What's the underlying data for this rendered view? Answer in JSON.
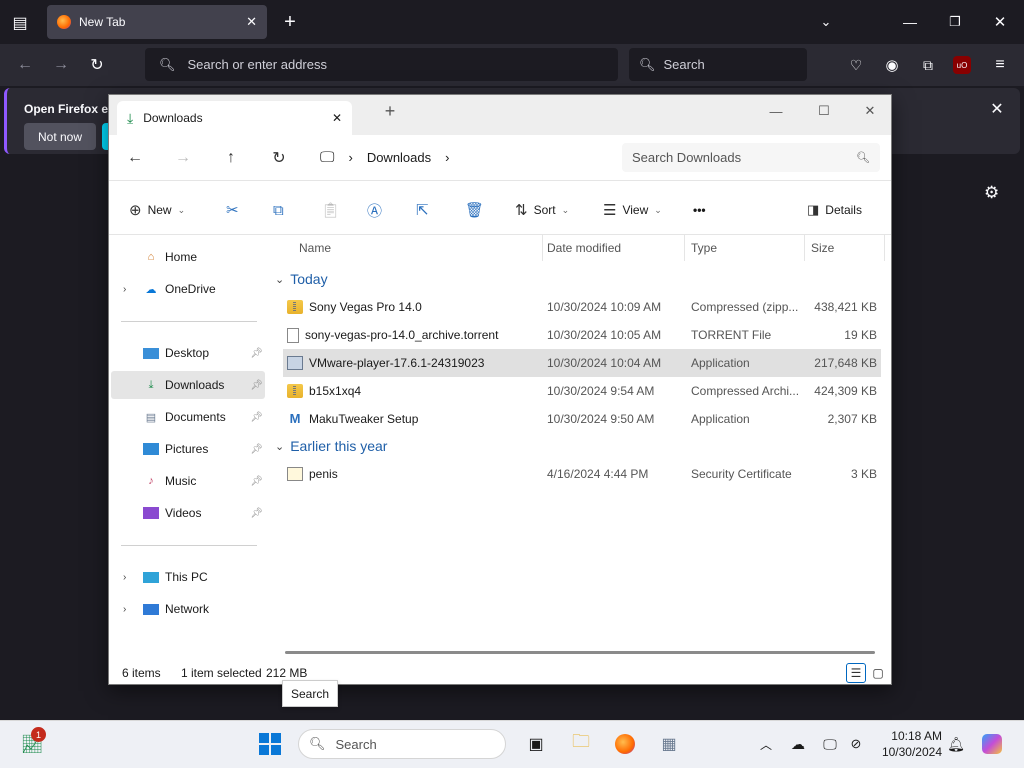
{
  "browser": {
    "tab_title": "New Tab",
    "url_placeholder": "Search or enter address",
    "search_placeholder": "Search",
    "notification_title": "Open Firefox ev",
    "notification_button": "Not now"
  },
  "explorer": {
    "tab_title": "Downloads",
    "breadcrumb": "Downloads",
    "search_placeholder": "Search Downloads",
    "toolbar": {
      "new": "New",
      "sort": "Sort",
      "view": "View",
      "more": "•••",
      "details": "Details"
    },
    "nav": [
      {
        "label": "Home"
      },
      {
        "label": "OneDrive"
      },
      {
        "label": "Desktop"
      },
      {
        "label": "Downloads"
      },
      {
        "label": "Documents"
      },
      {
        "label": "Pictures"
      },
      {
        "label": "Music"
      },
      {
        "label": "Videos"
      },
      {
        "label": "This PC"
      },
      {
        "label": "Network"
      }
    ],
    "columns": {
      "name": "Name",
      "date": "Date modified",
      "type": "Type",
      "size": "Size"
    },
    "groups": {
      "today": "Today",
      "earlier": "Earlier this year"
    },
    "files": [
      {
        "name": "Sony Vegas Pro 14.0",
        "date": "10/30/2024 10:09 AM",
        "type": "Compressed (zipp...",
        "size": "438,421 KB"
      },
      {
        "name": "sony-vegas-pro-14.0_archive.torrent",
        "date": "10/30/2024 10:05 AM",
        "type": "TORRENT File",
        "size": "19 KB"
      },
      {
        "name": "VMware-player-17.6.1-24319023",
        "date": "10/30/2024 10:04 AM",
        "type": "Application",
        "size": "217,648 KB"
      },
      {
        "name": "b15x1xq4",
        "date": "10/30/2024 9:54 AM",
        "type": "Compressed Archi...",
        "size": "424,309 KB"
      },
      {
        "name": "MakuTweaker Setup",
        "date": "10/30/2024 9:50 AM",
        "type": "Application",
        "size": "2,307 KB"
      },
      {
        "name": "penis",
        "date": "4/16/2024 4:44 PM",
        "type": "Security Certificate",
        "size": "3 KB"
      }
    ],
    "status": {
      "items": "6 items",
      "selected": "1 item selected",
      "size": "212 MB"
    },
    "tooltip": "Search"
  },
  "taskbar": {
    "search_placeholder": "Search",
    "time": "10:18 AM",
    "date": "10/30/2024",
    "badge": "1"
  }
}
